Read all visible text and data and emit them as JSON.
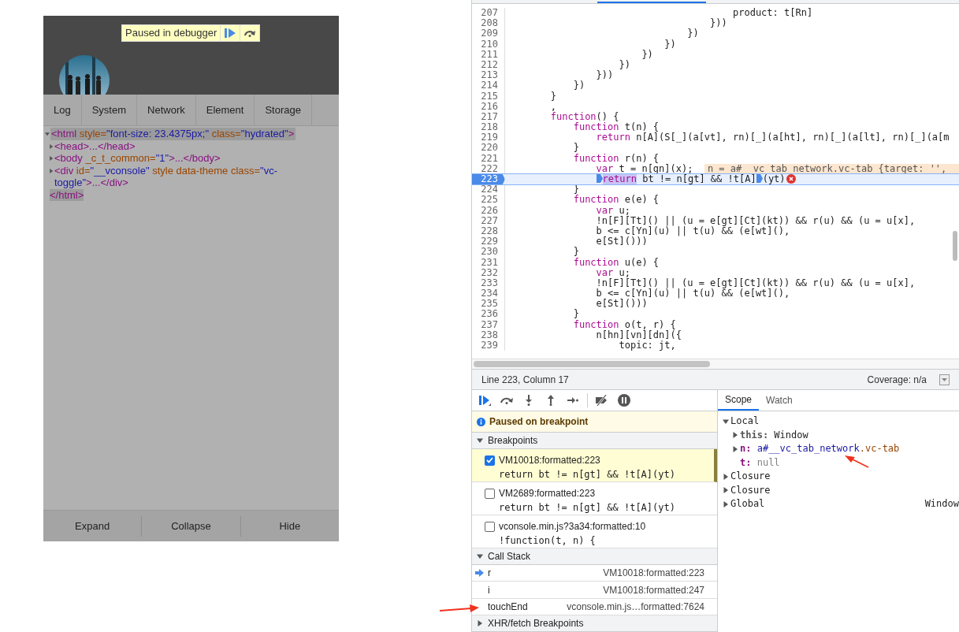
{
  "vconsole": {
    "debugger_banner": {
      "text": "Paused in debugger"
    },
    "avatar": {
      "kind": "picture"
    },
    "tabs": [
      {
        "label": "Log"
      },
      {
        "label": "System"
      },
      {
        "label": "Network"
      },
      {
        "label": "Element"
      },
      {
        "label": "Storage"
      }
    ],
    "element_tree": [
      {
        "expanded": true,
        "highlighted": true,
        "tokens": [
          {
            "kind": "tag",
            "text": "<html"
          },
          {
            "kind": "attr",
            "text": " style="
          },
          {
            "kind": "value",
            "text": "\"font-size: 23.4375px;\""
          },
          {
            "kind": "attr",
            "text": " class="
          },
          {
            "kind": "value",
            "text": "\"hydrated\""
          },
          {
            "kind": "tag",
            "text": ">"
          }
        ],
        "children": [
          {
            "expanded": false,
            "highlighted": false,
            "tokens": [
              {
                "kind": "tag",
                "text": "<head>...</head>"
              }
            ]
          },
          {
            "expanded": false,
            "highlighted": false,
            "tokens": [
              {
                "kind": "tag",
                "text": "<body"
              },
              {
                "kind": "attr",
                "text": " _c_t_common="
              },
              {
                "kind": "value",
                "text": "\"1\""
              },
              {
                "kind": "tag",
                "text": ">...</body>"
              }
            ]
          },
          {
            "expanded": false,
            "highlighted": false,
            "tokens": [
              {
                "kind": "tag",
                "text": "<div"
              },
              {
                "kind": "attr",
                "text": " id="
              },
              {
                "kind": "value",
                "text": "\"__vconsole\""
              },
              {
                "kind": "attr",
                "text": " style"
              },
              {
                "kind": "attr",
                "text": " data-theme"
              },
              {
                "kind": "attr",
                "text": " class="
              },
              {
                "kind": "value",
                "text": "\"vc-toggle\""
              },
              {
                "kind": "tag",
                "text": ">...</div>"
              }
            ]
          }
        ],
        "closing": "</html>"
      }
    ],
    "footer_buttons": [
      "Expand",
      "Collapse",
      "Hide"
    ]
  },
  "devtools": {
    "code": {
      "lines": [
        {
          "number": "207",
          "current": false,
          "tokens": [
            {
              "kind": "plain",
              "text": "                                        product: t[Rn]"
            }
          ]
        },
        {
          "number": "208",
          "current": false,
          "tokens": [
            {
              "kind": "plain",
              "text": "                                    }))"
            }
          ]
        },
        {
          "number": "209",
          "current": false,
          "tokens": [
            {
              "kind": "plain",
              "text": "                                })"
            }
          ]
        },
        {
          "number": "210",
          "current": false,
          "tokens": [
            {
              "kind": "plain",
              "text": "                            })"
            }
          ]
        },
        {
          "number": "211",
          "current": false,
          "tokens": [
            {
              "kind": "plain",
              "text": "                        })"
            }
          ]
        },
        {
          "number": "212",
          "current": false,
          "tokens": [
            {
              "kind": "plain",
              "text": "                    })"
            }
          ]
        },
        {
          "number": "213",
          "current": false,
          "tokens": [
            {
              "kind": "plain",
              "text": "                }))"
            }
          ]
        },
        {
          "number": "214",
          "current": false,
          "tokens": [
            {
              "kind": "plain",
              "text": "            })"
            }
          ]
        },
        {
          "number": "215",
          "current": false,
          "tokens": [
            {
              "kind": "plain",
              "text": "        }"
            }
          ]
        },
        {
          "number": "216",
          "current": false,
          "tokens": [
            {
              "kind": "plain",
              "text": "        ,"
            }
          ]
        },
        {
          "number": "217",
          "current": false,
          "tokens": [
            {
              "kind": "kw",
              "text": "        function"
            },
            {
              "kind": "plain",
              "text": "() {"
            }
          ]
        },
        {
          "number": "218",
          "current": false,
          "tokens": [
            {
              "kind": "kw",
              "text": "            function"
            },
            {
              "kind": "plain",
              "text": " t(n) {"
            }
          ]
        },
        {
          "number": "219",
          "current": false,
          "tokens": [
            {
              "kind": "kw",
              "text": "                return"
            },
            {
              "kind": "plain",
              "text": " n[A](S[_](a[vt], rn)[_](a[ht], rn)[_](a[lt], rn)[_](a[m"
            }
          ]
        },
        {
          "number": "220",
          "current": false,
          "tokens": [
            {
              "kind": "plain",
              "text": "            }"
            }
          ]
        },
        {
          "number": "221",
          "current": false,
          "tokens": [
            {
              "kind": "kw",
              "text": "            function"
            },
            {
              "kind": "plain",
              "text": " r(n) {"
            }
          ]
        },
        {
          "number": "222",
          "current": false,
          "tokens": [
            {
              "kind": "kw",
              "text": "                var"
            },
            {
              "kind": "plain",
              "text": " t = n[gn](x);  "
            },
            {
              "kind": "inline-value",
              "text": "n = a#__vc_tab_network.vc-tab {target: '',"
            }
          ]
        },
        {
          "number": "223",
          "current": true,
          "tokens": [
            {
              "kind": "kw-bp",
              "text": "                return"
            },
            {
              "kind": "plain",
              "text": " bt != n[gt] && !t[A]"
            },
            {
              "kind": "plain-bp",
              "text": "(yt)"
            },
            {
              "kind": "error"
            }
          ]
        },
        {
          "number": "224",
          "current": false,
          "tokens": [
            {
              "kind": "plain",
              "text": "            }"
            }
          ]
        },
        {
          "number": "225",
          "current": false,
          "tokens": [
            {
              "kind": "kw",
              "text": "            function"
            },
            {
              "kind": "plain",
              "text": " e(e) {"
            }
          ]
        },
        {
          "number": "226",
          "current": false,
          "tokens": [
            {
              "kind": "kw",
              "text": "                var"
            },
            {
              "kind": "plain",
              "text": " u;"
            }
          ]
        },
        {
          "number": "227",
          "current": false,
          "tokens": [
            {
              "kind": "plain",
              "text": "                !n[F][Tt]() || (u = e[gt][Ct](kt)) && r(u) && (u = u[x],"
            }
          ]
        },
        {
          "number": "228",
          "current": false,
          "tokens": [
            {
              "kind": "plain",
              "text": "                b <= c[Yn](u) || t(u) && (e[wt](),"
            }
          ]
        },
        {
          "number": "229",
          "current": false,
          "tokens": [
            {
              "kind": "plain",
              "text": "                e[St]()))"
            }
          ]
        },
        {
          "number": "230",
          "current": false,
          "tokens": [
            {
              "kind": "plain",
              "text": "            }"
            }
          ]
        },
        {
          "number": "231",
          "current": false,
          "tokens": [
            {
              "kind": "kw",
              "text": "            function"
            },
            {
              "kind": "plain",
              "text": " u(e) {"
            }
          ]
        },
        {
          "number": "232",
          "current": false,
          "tokens": [
            {
              "kind": "kw",
              "text": "                var"
            },
            {
              "kind": "plain",
              "text": " u;"
            }
          ]
        },
        {
          "number": "233",
          "current": false,
          "tokens": [
            {
              "kind": "plain",
              "text": "                !n[F][Tt]() || (u = e[gt][Ct](kt)) && r(u) && (u = u[x],"
            }
          ]
        },
        {
          "number": "234",
          "current": false,
          "tokens": [
            {
              "kind": "plain",
              "text": "                b <= c[Yn](u) || t(u) && (e[wt](),"
            }
          ]
        },
        {
          "number": "235",
          "current": false,
          "tokens": [
            {
              "kind": "plain",
              "text": "                e[St]()))"
            }
          ]
        },
        {
          "number": "236",
          "current": false,
          "tokens": [
            {
              "kind": "plain",
              "text": "            }"
            }
          ]
        },
        {
          "number": "237",
          "current": false,
          "tokens": [
            {
              "kind": "kw",
              "text": "            function"
            },
            {
              "kind": "plain",
              "text": " o(t, r) {"
            }
          ]
        },
        {
          "number": "238",
          "current": false,
          "tokens": [
            {
              "kind": "plain",
              "text": "                n[hn][vn][dn]({"
            }
          ]
        },
        {
          "number": "239",
          "current": false,
          "tokens": [
            {
              "kind": "plain",
              "text": "                    topic: jt,"
            }
          ]
        }
      ]
    },
    "status_bar": {
      "position": "Line 223, Column 17",
      "coverage": "Coverage: n/a"
    },
    "pause_banner": "Paused on breakpoint",
    "breakpoints": {
      "title": "Breakpoints",
      "expanded": true,
      "items": [
        {
          "location": "VM10018:formatted:223",
          "code": "return bt != n[gt] && !t[A](yt)",
          "checked": true,
          "selected": true
        },
        {
          "location": "VM2689:formatted:223",
          "code": "return bt != n[gt] && !t[A](yt)",
          "checked": false,
          "selected": false
        },
        {
          "location": "vconsole.min.js?3a34:formatted:10",
          "code": "!function(t, n) {",
          "checked": false,
          "selected": false
        }
      ]
    },
    "call_stack": {
      "title": "Call Stack",
      "expanded": true,
      "frames": [
        {
          "name": "r",
          "location": "VM10018:formatted:223",
          "current": true
        },
        {
          "name": "i",
          "location": "VM10018:formatted:247",
          "current": false
        },
        {
          "name": "touchEnd",
          "location": "vconsole.min.js…formatted:7624",
          "current": false
        }
      ]
    },
    "xhr_breakpoints": {
      "title": "XHR/fetch Breakpoints",
      "expanded": false
    },
    "scope_tabs": [
      {
        "label": "Scope",
        "selected": true
      },
      {
        "label": "Watch",
        "selected": false
      }
    ],
    "scope_tree": [
      {
        "label": "Local",
        "expanded": true,
        "children": [
          {
            "kind": "special",
            "key": "this:",
            "tokens": [
              {
                "kind": "plain",
                "text": "Window"
              }
            ]
          },
          {
            "kind": "object",
            "key": "n:",
            "tokens": [
              {
                "kind": "node",
                "text": "a#__vc_tab_network"
              },
              {
                "kind": "class",
                "text": ".vc-tab"
              }
            ]
          },
          {
            "kind": "primitive",
            "key": "t:",
            "tokens": [
              {
                "kind": "null",
                "text": "null"
              }
            ]
          }
        ]
      },
      {
        "label": "Closure",
        "expanded": false
      },
      {
        "label": "Closure",
        "expanded": false
      },
      {
        "label": "Global",
        "expanded": false,
        "value": "Window"
      }
    ]
  }
}
